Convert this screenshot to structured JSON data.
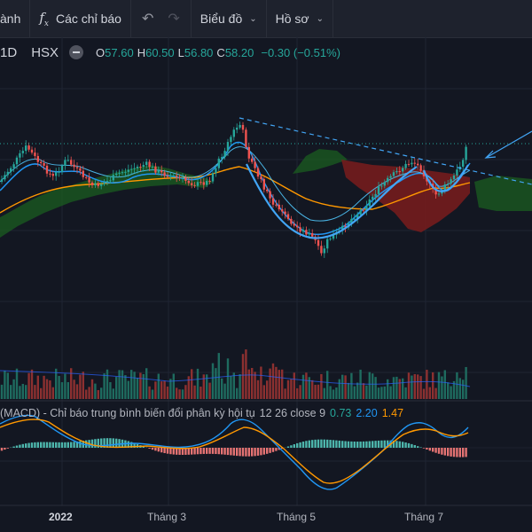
{
  "toolbar": {
    "partial_left": "ành",
    "indicators": "Các chỉ báo",
    "indicators_icon": "fx-icon",
    "chart_type": "Biểu đồ",
    "profile": "Hồ sơ"
  },
  "legend": {
    "interval": "1D",
    "exchange": "HSX",
    "open_label": "O",
    "open": "57.60",
    "high_label": "H",
    "high": "60.50",
    "low_label": "L",
    "low": "56.80",
    "close_label": "C",
    "close": "58.20",
    "change": "−0.30 (−0.51%)"
  },
  "macd": {
    "title": "(MACD) - Chỉ báo trung bình biến đổi phân kỳ hội tụ",
    "params": "12 26 close 9",
    "hist": "0.73",
    "macd": "2.20",
    "signal": "1.47"
  },
  "xaxis": {
    "labels": [
      "2022",
      "Tháng 3",
      "Tháng 5",
      "Tháng 7"
    ]
  },
  "colors": {
    "bg": "#131722",
    "up": "#26a69a",
    "down": "#ef5350",
    "macd_line": "#2196f3",
    "signal_line": "#ff9800",
    "cloud_green": "#1b5e20",
    "cloud_red": "#8b1a1a"
  }
}
